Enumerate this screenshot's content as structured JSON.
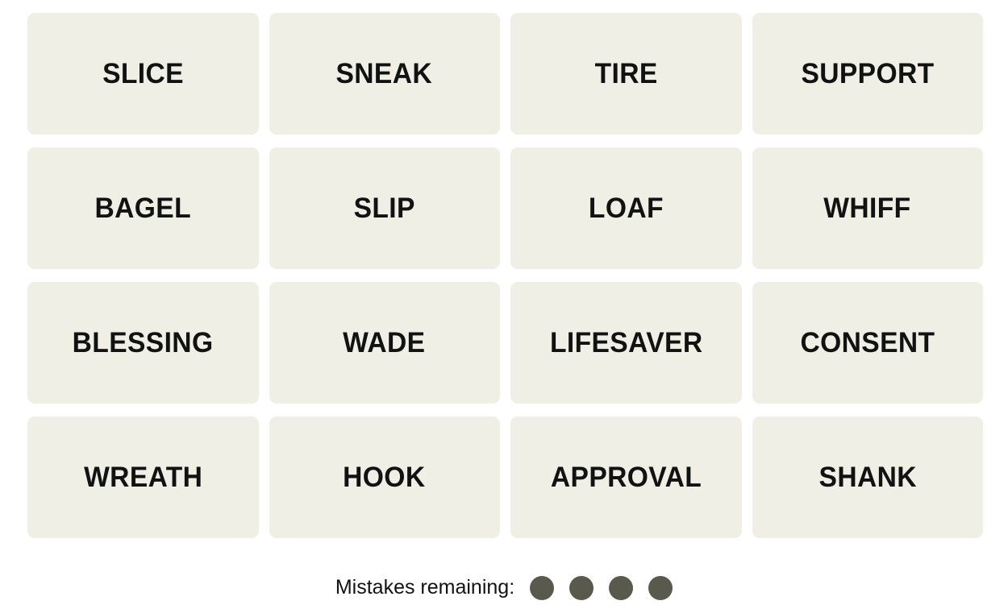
{
  "game": {
    "name": "Connections",
    "tile_bg_color": "#EFEFE6",
    "tile_text_color": "#121212",
    "page_bg_color": "#FFFFFF",
    "mistake_dot_color": "#5A594E"
  },
  "grid": {
    "rows": 4,
    "columns": 4,
    "tiles": [
      {
        "label": "SLICE"
      },
      {
        "label": "SNEAK"
      },
      {
        "label": "TIRE"
      },
      {
        "label": "SUPPORT"
      },
      {
        "label": "BAGEL"
      },
      {
        "label": "SLIP"
      },
      {
        "label": "LOAF"
      },
      {
        "label": "WHIFF"
      },
      {
        "label": "BLESSING"
      },
      {
        "label": "WADE"
      },
      {
        "label": "LIFESAVER"
      },
      {
        "label": "CONSENT"
      },
      {
        "label": "WREATH"
      },
      {
        "label": "HOOK"
      },
      {
        "label": "APPROVAL"
      },
      {
        "label": "SHANK"
      }
    ]
  },
  "footer": {
    "mistakes_label": "Mistakes remaining:",
    "mistakes_remaining": 4,
    "dots": [
      {
        "state": "filled"
      },
      {
        "state": "filled"
      },
      {
        "state": "filled"
      },
      {
        "state": "filled"
      }
    ]
  }
}
